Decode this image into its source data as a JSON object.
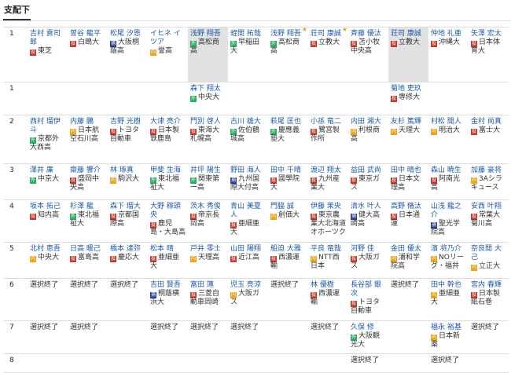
{
  "tab_label": "支配下",
  "badges": {
    "投": {
      "color": "#c0392b"
    },
    "外": {
      "color": "#27ae60"
    },
    "捕": {
      "color": "#2c3e8f"
    },
    "内": {
      "color": "#e8a317"
    }
  },
  "rows": [
    {
      "round": "1",
      "cells": [
        {
          "name": "吉村 貢司郎",
          "pos": "投",
          "school": "東芝"
        },
        {
          "name": "曽谷 龍平",
          "pos": "投",
          "school": "白鴎大"
        },
        {
          "name": "松尾 汐恩",
          "pos": "捕",
          "school": "大阪桐蔭高"
        },
        {
          "name": "イヒネ イツア",
          "pos": "内",
          "school": "誉高"
        },
        {
          "name": "浅野 翔吾",
          "pos": "外",
          "school": "高松商高",
          "hl": true
        },
        {
          "name": "蛭間 拓哉",
          "pos": "外",
          "school": "早稲田大"
        },
        {
          "name": "浅野 翔吾",
          "pos": "外",
          "school": "高松商高",
          "star": true
        },
        {
          "name": "荘司 康誠",
          "pos": "投",
          "school": "立教大",
          "star": true
        },
        {
          "name": "斉藤 優汰",
          "pos": "投",
          "school": "苫小牧中央高"
        },
        {
          "name": "荘司 康誠",
          "pos": "投",
          "school": "立教大",
          "hl": true
        },
        {
          "name": "仲地 礼亜",
          "pos": "投",
          "school": "沖縄大"
        },
        {
          "name": "矢澤 宏太",
          "pos": "投",
          "school": "日本体育大"
        }
      ]
    },
    {
      "round": "1",
      "cells": [
        null,
        null,
        null,
        null,
        {
          "name": "森下 翔太",
          "pos": "外",
          "school": "中央大"
        },
        null,
        null,
        null,
        null,
        {
          "name": "菊地 吏玖",
          "pos": "投",
          "school": "専修大"
        },
        null,
        null
      ]
    },
    {
      "round": "2",
      "cells": [
        {
          "name": "西村 瑠伊斗",
          "pos": "外",
          "school": "京都外大西高"
        },
        {
          "name": "内藤 鵬",
          "pos": "内",
          "school": "日本航空石川高"
        },
        {
          "name": "吉野 光樹",
          "pos": "投",
          "school": "トヨタ自動車"
        },
        {
          "name": "大津 亮介",
          "pos": "投",
          "school": "日本製鉄鹿島"
        },
        {
          "name": "門別 啓人",
          "pos": "投",
          "school": "東海大札幌高"
        },
        {
          "name": "古川 雄大",
          "pos": "外",
          "school": "佐伯鶴城高"
        },
        {
          "name": "萩尾 匡也",
          "pos": "外",
          "school": "慶應義塾大"
        },
        {
          "name": "小孫 竜二",
          "pos": "投",
          "school": "鷺宮製作所"
        },
        {
          "name": "内田 湘大",
          "pos": "内",
          "school": "利根商高"
        },
        {
          "name": "友杉 篤輝",
          "pos": "内",
          "school": "天理大"
        },
        {
          "name": "村松 開人",
          "pos": "内",
          "school": "明治大"
        },
        {
          "name": "金村 尚真",
          "pos": "投",
          "school": "富士大"
        }
      ]
    },
    {
      "round": "3",
      "cells": [
        {
          "name": "澤井 廉",
          "pos": "外",
          "school": "中京大"
        },
        {
          "name": "齋藤 響介",
          "pos": "投",
          "school": "盛岡中央高"
        },
        {
          "name": "林 琢真",
          "pos": "内",
          "school": "駒沢大"
        },
        {
          "name": "甲斐 生海",
          "pos": "外",
          "school": "東北福祉大"
        },
        {
          "name": "井坪 陽生",
          "pos": "外",
          "school": "関東第一高"
        },
        {
          "name": "野田 海人",
          "pos": "捕",
          "school": "九州国際大付高"
        },
        {
          "name": "田中 千晴",
          "pos": "投",
          "school": "國學院大"
        },
        {
          "name": "渡辺 翔太",
          "pos": "投",
          "school": "九州産業大"
        },
        {
          "name": "益田 武尚",
          "pos": "投",
          "school": "東京ガス"
        },
        {
          "name": "田中 晴也",
          "pos": "投",
          "school": "日本文理高"
        },
        {
          "name": "森山 暁生",
          "pos": "投",
          "school": "阿南光高"
        },
        {
          "name": "加藤 豪将",
          "pos": "内",
          "school": "3Aシラキュース"
        }
      ]
    },
    {
      "round": "4",
      "cells": [
        {
          "name": "坂本 拓己",
          "pos": "投",
          "school": "知内高"
        },
        {
          "name": "杉澤 龍",
          "pos": "外",
          "school": "東北福祉大"
        },
        {
          "name": "森下 瑠大",
          "pos": "投",
          "school": "京都国際高"
        },
        {
          "name": "大野 稼頭央",
          "pos": "投",
          "school": "鹿児島・大島高"
        },
        {
          "name": "茨木 秀俊",
          "pos": "投",
          "school": "帝京長岡高"
        },
        {
          "name": "青山 美夏人",
          "pos": "投",
          "school": "亜細亜大"
        },
        {
          "name": "門脇 誠",
          "pos": "内",
          "school": "創価大"
        },
        {
          "name": "伊藤 茉央",
          "pos": "投",
          "school": "東京農業大北海道オホーツク"
        },
        {
          "name": "清水 叶人",
          "pos": "捕",
          "school": "健大高崎高"
        },
        {
          "name": "高野 脩汰",
          "pos": "投",
          "school": "日本通運"
        },
        {
          "name": "山浅 龍之介",
          "pos": "捕",
          "school": "聖光学院高"
        },
        {
          "name": "安西 叶翔",
          "pos": "投",
          "school": "常葉大菊川高"
        }
      ]
    },
    {
      "round": "5",
      "cells": [
        {
          "name": "北村 恵吾",
          "pos": "内",
          "school": "中央大"
        },
        {
          "name": "日高 暖己",
          "pos": "投",
          "school": "富島高"
        },
        {
          "name": "橋本 達弥",
          "pos": "投",
          "school": "慶応大"
        },
        {
          "name": "松本 晴",
          "pos": "投",
          "school": "亜細亜大"
        },
        {
          "name": "戸井 零士",
          "pos": "内",
          "school": "天理高"
        },
        {
          "name": "山田 陽翔",
          "pos": "投",
          "school": "近江高"
        },
        {
          "name": "船迫 大雅",
          "pos": "投",
          "school": "西濃運輸"
        },
        {
          "name": "平良 竜哉",
          "pos": "内",
          "school": "NTT西日本"
        },
        {
          "name": "河野 佳",
          "pos": "投",
          "school": "大阪ガス"
        },
        {
          "name": "金田 優太",
          "pos": "内",
          "school": "浦和学院高"
        },
        {
          "name": "濱 将乃介",
          "pos": "内",
          "school": "NOリーグ・福井"
        },
        {
          "name": "奈良間 大己",
          "pos": "内",
          "school": "立正大"
        }
      ]
    },
    {
      "round": "6",
      "cells": [
        {
          "text": "選択終了"
        },
        {
          "text": "選択終了"
        },
        {
          "text": "選択終了"
        },
        {
          "name": "吉田 賢吾",
          "pos": "捕",
          "school": "桐蔭横浜大"
        },
        {
          "name": "富田 蓮",
          "pos": "投",
          "school": "三菱自動車岡崎"
        },
        {
          "name": "児玉 亮涼",
          "pos": "内",
          "school": "大阪ガス"
        },
        {
          "text": "選択終了"
        },
        {
          "name": "林 優樹",
          "pos": "投",
          "school": "西濃運輸"
        },
        {
          "name": "長谷部 銀次",
          "pos": "投",
          "school": "トヨタ自動車"
        },
        {
          "text": "選択終了"
        },
        {
          "name": "田中 幹也",
          "pos": "内",
          "school": "亜細亜大"
        },
        {
          "name": "宮内 春輝",
          "pos": "投",
          "school": "日本製紙石巻"
        }
      ]
    },
    {
      "round": "7",
      "cells": [
        {
          "text": "選択終了"
        },
        {
          "text": "選択終了"
        },
        null,
        {
          "text": "選択終了"
        },
        {
          "text": "選択終了"
        },
        {
          "text": "選択終了"
        },
        null,
        {
          "text": "選択終了"
        },
        {
          "name": "久保 修",
          "pos": "外",
          "school": "大阪観光大"
        },
        null,
        {
          "name": "福永 裕基",
          "pos": "内",
          "school": "日本新薬"
        },
        {
          "text": "選択終了"
        }
      ]
    },
    {
      "round": "8",
      "cells": [
        null,
        null,
        null,
        null,
        null,
        null,
        null,
        null,
        {
          "text": "選択終了"
        },
        null,
        {
          "text": "選択終了"
        },
        null
      ]
    }
  ]
}
